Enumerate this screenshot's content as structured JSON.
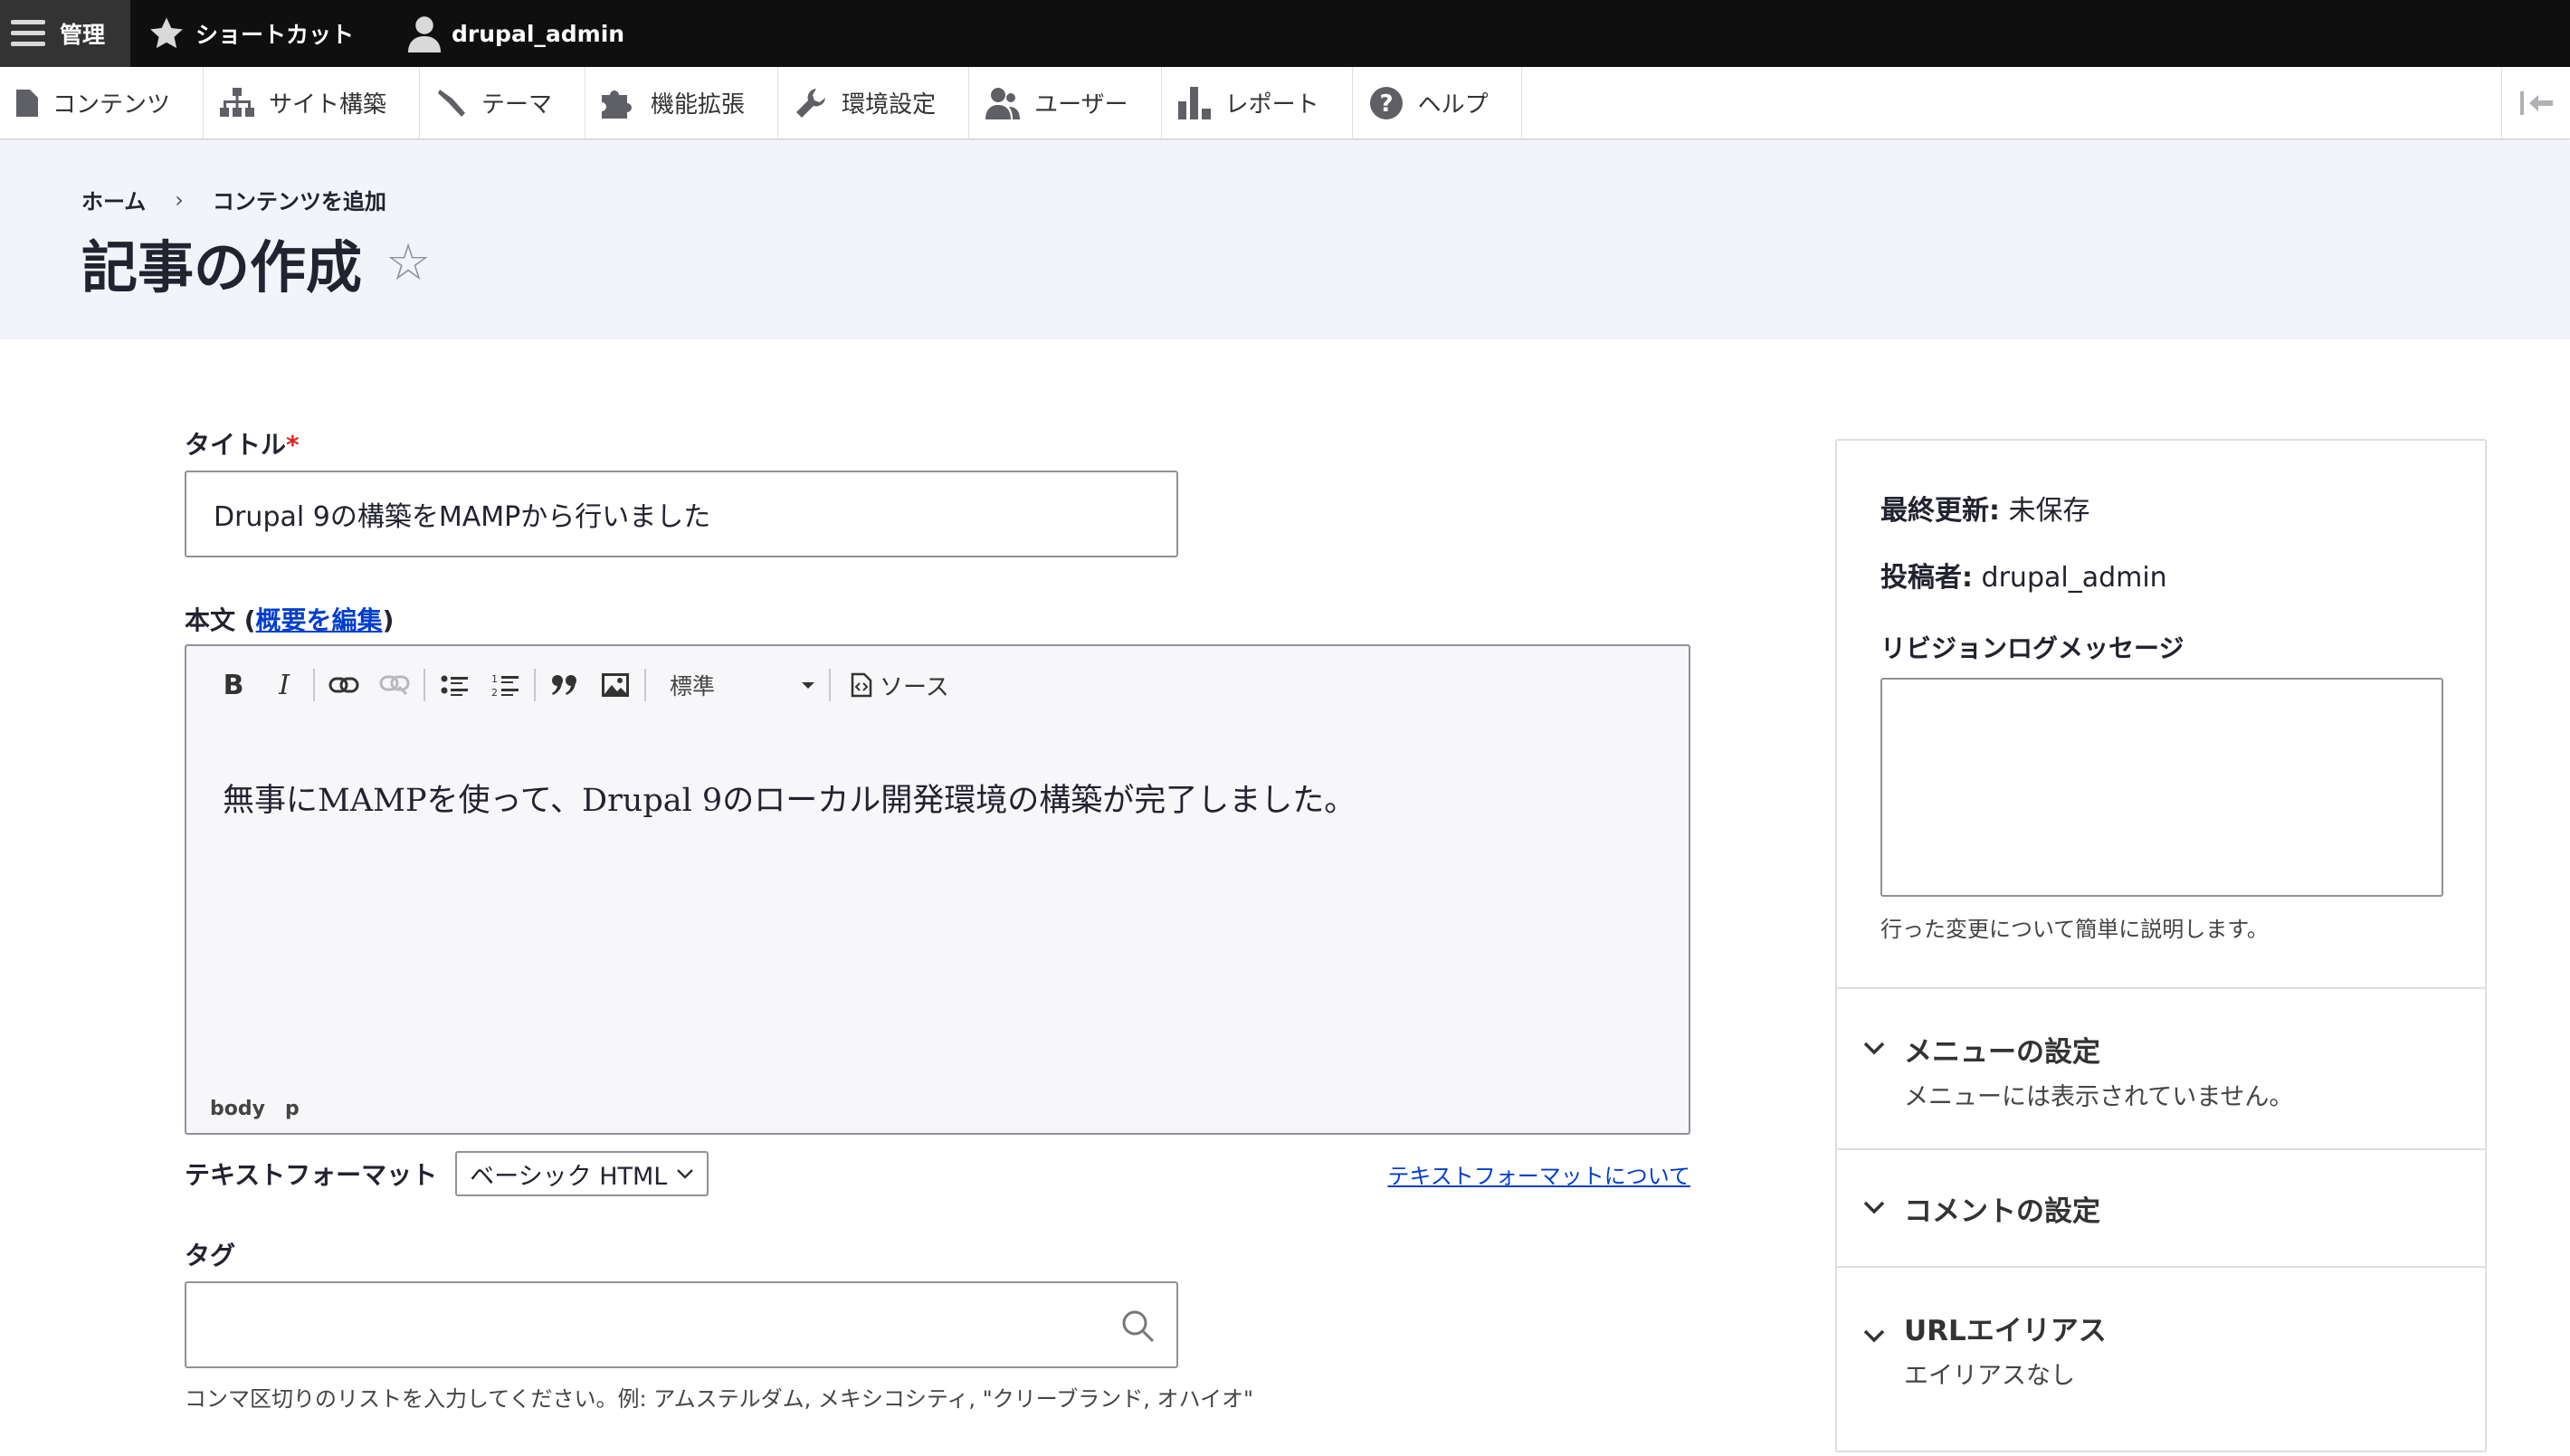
{
  "toolbar": {
    "manage_label": "管理",
    "shortcuts_label": "ショートカット",
    "user_label": "drupal_admin"
  },
  "tray": {
    "items": [
      {
        "label": "コンテンツ",
        "icon": "file-icon"
      },
      {
        "label": "サイト構築",
        "icon": "sitemap-icon"
      },
      {
        "label": "テーマ",
        "icon": "paintbrush-icon"
      },
      {
        "label": "機能拡張",
        "icon": "puzzle-icon"
      },
      {
        "label": "環境設定",
        "icon": "wrench-icon"
      },
      {
        "label": "ユーザー",
        "icon": "people-icon"
      },
      {
        "label": "レポート",
        "icon": "bar-chart-icon"
      },
      {
        "label": "ヘルプ",
        "icon": "help-icon"
      }
    ]
  },
  "header": {
    "breadcrumb": [
      "ホーム",
      "コンテンツを追加"
    ],
    "separator": "›",
    "title": "記事の作成",
    "star": "☆"
  },
  "form": {
    "title_label": "タイトル",
    "required_mark": "*",
    "title_value": "Drupal 9の構築をMAMPから行いました",
    "body_label_prefix": "本文 (",
    "body_label_link": "概要を編集",
    "body_label_suffix": ")",
    "editor": {
      "heading_select": "標準",
      "source_label": "ソース",
      "content": "無事にMAMPを使って、Drupal 9のローカル開発環境の構築が完了しました。",
      "path": [
        "body",
        "p"
      ]
    },
    "text_format_label": "テキストフォーマット",
    "text_format_value": "ベーシック HTML",
    "text_format_link": "テキストフォーマットについて",
    "tags_label": "タグ",
    "tags_value": "",
    "tags_description": "コンマ区切りのリストを入力してください。例: アムステルダム, メキシコシティ, \"クリーブランド, オハイオ\""
  },
  "sidebar": {
    "last_saved_label": "最終更新:",
    "last_saved_value": "未保存",
    "author_label": "投稿者:",
    "author_value": "drupal_admin",
    "revision_label": "リビジョンログメッセージ",
    "revision_value": "",
    "revision_description": "行った変更について簡単に説明します。",
    "sections": [
      {
        "title": "メニューの設定",
        "summary": "メニューには表示されていません。"
      },
      {
        "title": "コメントの設定",
        "summary": ""
      },
      {
        "title": "URLエイリアス",
        "summary": "エイリアスなし"
      }
    ]
  }
}
